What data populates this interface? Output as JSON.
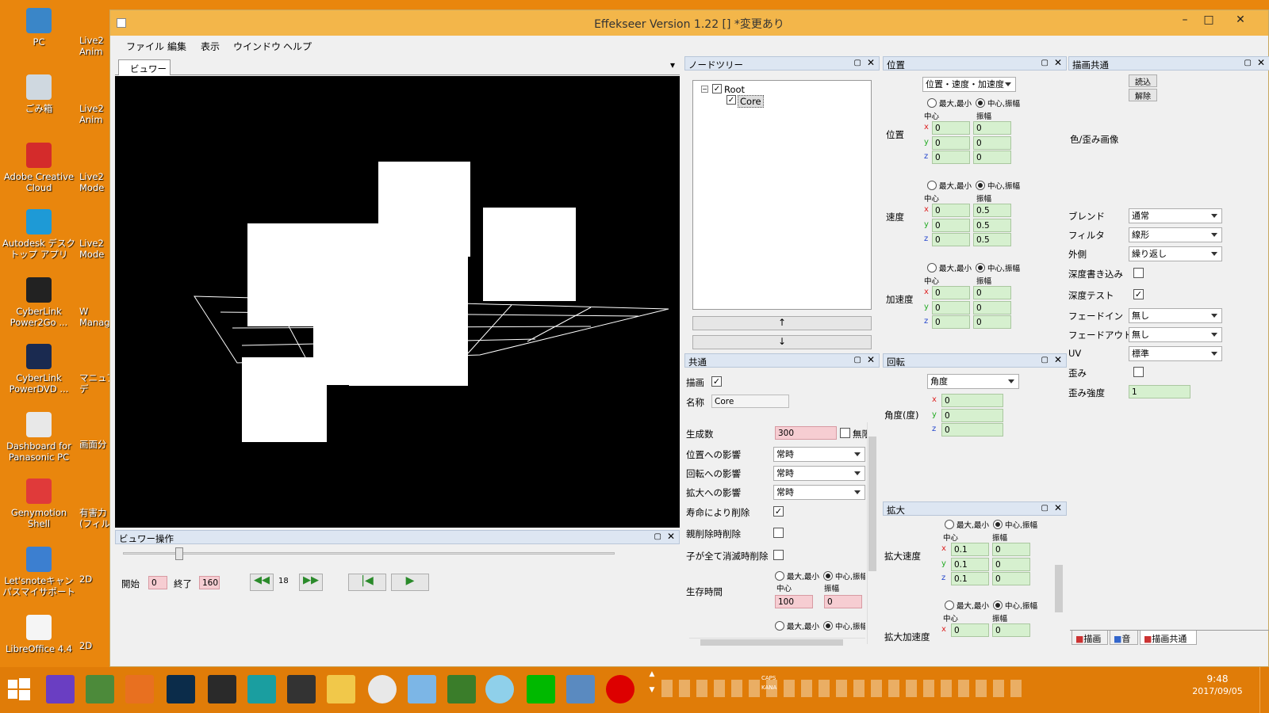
{
  "colors": {
    "desktop": "#e9860d",
    "titlebar": "#f3b64a",
    "field_green": "#d6f0cf",
    "field_pink": "#f6cdd2",
    "viewer_bg": "#000000",
    "panel_header": "#dde6f2"
  },
  "desktop": {
    "icons": [
      "PC",
      "ごみ箱",
      "Adobe Creative Cloud",
      "Autodesk デスクトップ アプリ",
      "CyberLink Power2Go ...",
      "CyberLink PowerDVD ...",
      "Dashboard for Panasonic PC",
      "Genymotion Shell",
      "Let'snoteキャンパスマイサポート",
      "LibreOffice 4.4"
    ],
    "col2": [
      "Live2",
      "Anim",
      "Live2",
      "Anim",
      "Live2",
      "Mode",
      "Live2",
      "Mode",
      "W",
      "Manag",
      "マニュア",
      "デ",
      "画面分",
      "有害力",
      "(フィルタ-",
      "2D",
      "2D"
    ]
  },
  "window": {
    "title": "Effekseer Version 1.22 [] *変更あり",
    "minimize": "–",
    "maximize": "□",
    "close": "✕"
  },
  "menu": [
    "ファイル",
    "編集",
    "表示",
    "ウインドウ",
    "ヘルプ"
  ],
  "viewer": {
    "tab": "ビュワー",
    "dropdown": "▾"
  },
  "viewer_ops": {
    "title": "ビュワー操作",
    "start_label": "開始",
    "start": "0",
    "end_label": "終了",
    "end": "160",
    "frame": "18"
  },
  "node_tree": {
    "title": "ノードツリー",
    "root": "Root",
    "child": "Core",
    "up": "↑",
    "down": "↓"
  },
  "position": {
    "title": "位置",
    "mode": "位置・速度・加速度",
    "minmax": "最大,最小",
    "centerrange": "中心,振幅",
    "center": "中心",
    "range": "振幅",
    "groups": [
      {
        "label": "位置",
        "center": [
          "0",
          "0",
          "0"
        ],
        "range": [
          "0",
          "0",
          "0"
        ]
      },
      {
        "label": "速度",
        "center": [
          "0",
          "0",
          "0"
        ],
        "range": [
          "0.5",
          "0.5",
          "0.5"
        ]
      },
      {
        "label": "加速度",
        "center": [
          "0",
          "0",
          "0"
        ],
        "range": [
          "0",
          "0",
          "0"
        ]
      }
    ]
  },
  "common": {
    "title": "共通",
    "draw": "描画",
    "name_label": "名称",
    "name": "Core",
    "gen_label": "生成数",
    "gen": "300",
    "infinite": "無限",
    "rows": [
      {
        "label": "位置への影響",
        "value": "常時"
      },
      {
        "label": "回転への影響",
        "value": "常時"
      },
      {
        "label": "拡大への影響",
        "value": "常時"
      }
    ],
    "life_delete": "寿命により削除",
    "parent_delete": "親削除時削除",
    "child_delete": "子が全て消滅時削除",
    "life_label": "生存時間",
    "life_center": "100",
    "life_range": "0"
  },
  "rotation": {
    "title": "回転",
    "mode": "角度",
    "label": "角度(度)",
    "values": [
      "0",
      "0",
      "0"
    ]
  },
  "scale": {
    "title": "拡大",
    "speed_label": "拡大速度",
    "speed_center": [
      "0.1",
      "0.1",
      "0.1"
    ],
    "speed_range": [
      "0",
      "0",
      "0"
    ],
    "accel_label": "拡大加速度",
    "accel_center": [
      "0"
    ],
    "accel_range": [
      "0"
    ]
  },
  "render_common": {
    "title": "描画共通",
    "load": "読込",
    "unload": "解除",
    "color_image": "色/歪み画像",
    "rows": [
      {
        "label": "ブレンド",
        "value": "通常"
      },
      {
        "label": "フィルタ",
        "value": "線形"
      },
      {
        "label": "外側",
        "value": "繰り返し"
      }
    ],
    "depth_write": "深度書き込み",
    "depth_test": "深度テスト",
    "fadein_label": "フェードイン",
    "fadein": "無し",
    "fadeout_label": "フェードアウト",
    "fadeout": "無し",
    "uv_label": "UV",
    "uv": "標準",
    "distortion": "歪み",
    "distortion_strength_label": "歪み強度",
    "distortion_strength": "1"
  },
  "bottom_tabs": [
    "描画",
    "音",
    "描画共通"
  ],
  "taskbar": {
    "time": "9:48",
    "date": "2017/09/05",
    "caps": "CAPS",
    "kana": "KANA"
  }
}
